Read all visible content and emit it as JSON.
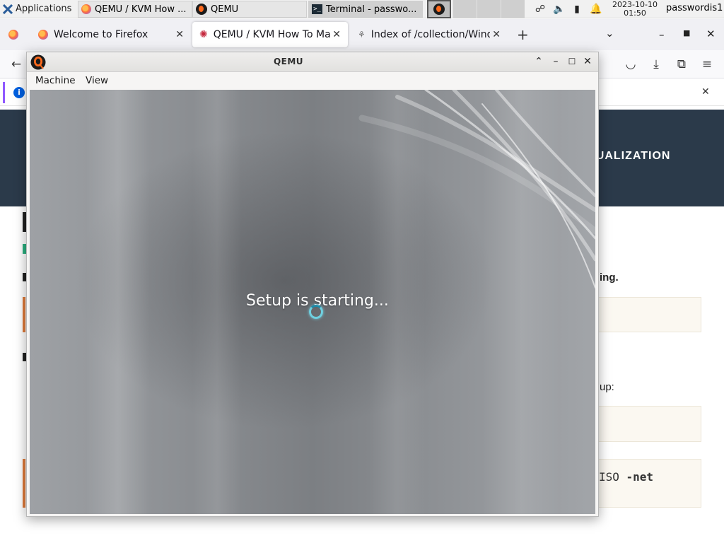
{
  "panel": {
    "applications_label": "Applications",
    "tasks": [
      {
        "label": "QEMU / KVM How ...",
        "icon": "firefox-icon"
      },
      {
        "label": "QEMU",
        "icon": "qemu-icon"
      },
      {
        "label": "Terminal - passwo...",
        "icon": "terminal-icon"
      }
    ],
    "clock_date": "2023-10-10",
    "clock_time": "01:50",
    "user": "passwordis1"
  },
  "firefox": {
    "tabs": [
      {
        "label": "Welcome to Firefox",
        "icon": "firefox-icon"
      },
      {
        "label": "QEMU / KVM How To Man",
        "icon": "site-icon",
        "selected": true
      },
      {
        "label": "Index of /collection/Wind",
        "icon": "page-icon"
      }
    ],
    "new_tab_symbol": "+",
    "page": {
      "header_nav": "TUALIZATION",
      "frag1": "ing.",
      "frag2": "up:",
      "code1": "ISO ",
      "code1_bold": "-net"
    }
  },
  "qemu": {
    "title": "QEMU",
    "menu": [
      "Machine",
      "View"
    ],
    "screen_text": "Setup is starting..."
  },
  "colors": {
    "site_header": "#2b3a4a",
    "accent_purple": "#9059ff",
    "spinner": "#6fd0e0"
  }
}
